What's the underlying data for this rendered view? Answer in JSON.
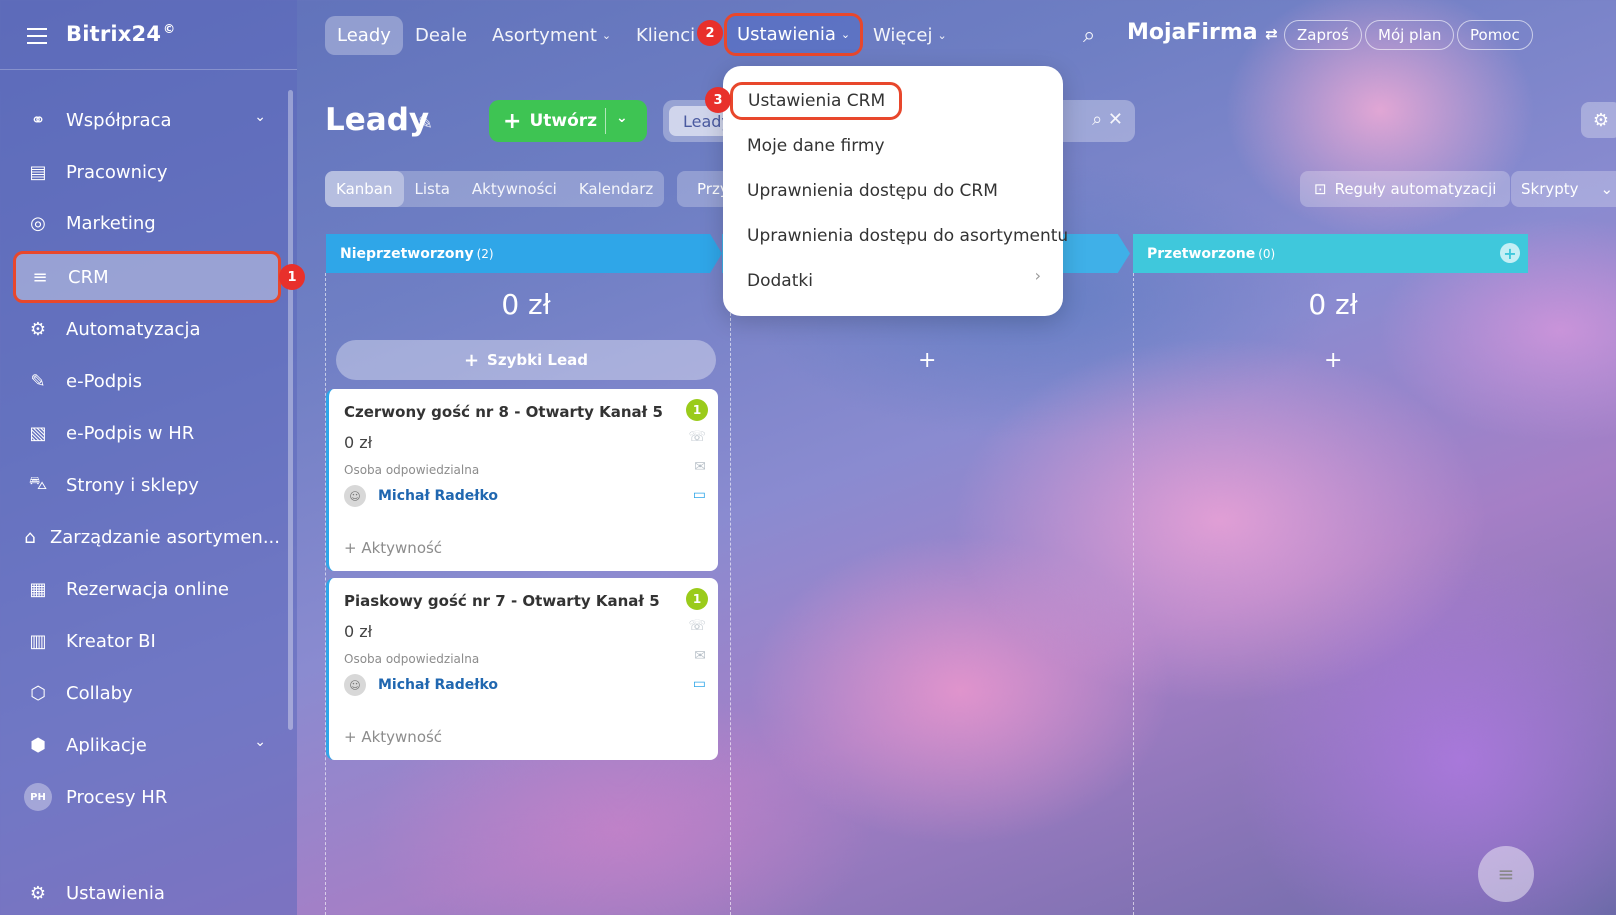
{
  "app": {
    "logo": "Bitrix24",
    "logo_mark": "©"
  },
  "sidebar": {
    "items": [
      {
        "label": "Współpraca",
        "icon": "collab-icon"
      },
      {
        "label": "Pracownicy",
        "icon": "employees-icon"
      },
      {
        "label": "Marketing",
        "icon": "marketing-icon"
      },
      {
        "label": "CRM",
        "icon": "crm-icon"
      },
      {
        "label": "Automatyzacja",
        "icon": "automation-icon"
      },
      {
        "label": "e-Podpis",
        "icon": "sign-icon"
      },
      {
        "label": "e-Podpis w HR",
        "icon": "hr-sign-icon"
      },
      {
        "label": "Strony i sklepy",
        "icon": "cart-icon"
      },
      {
        "label": "Zarządzanie asortymen...",
        "icon": "inventory-icon"
      },
      {
        "label": "Rezerwacja online",
        "icon": "calendar-icon"
      },
      {
        "label": "Kreator BI",
        "icon": "bi-chart-icon"
      },
      {
        "label": "Collaby",
        "icon": "collaby-icon"
      },
      {
        "label": "Aplikacje",
        "icon": "apps-icon"
      },
      {
        "label": "Procesy HR",
        "icon": "hr-process-icon",
        "avatar_text": "PH"
      },
      {
        "label": "Ustawienia",
        "icon": "gear-icon"
      }
    ]
  },
  "topnav": {
    "items": [
      "Leady",
      "Deale",
      "Asortyment",
      "Klienci",
      "Ustawienia",
      "Więcej"
    ],
    "company": "MojaFirma",
    "invite": "Zaproś",
    "plan": "Mój plan",
    "help": "Pomoc"
  },
  "badges": {
    "one": "1",
    "two": "2",
    "three": "3"
  },
  "toolbar": {
    "title": "Leady",
    "create": "Utwórz",
    "filter_tag": "Leady"
  },
  "views": [
    "Kanban",
    "Lista",
    "Aktywności",
    "Kalendarz"
  ],
  "views_extra": "Przy",
  "automation": "Reguły automatyzacji",
  "scripts": "Skrypty",
  "columns": [
    {
      "name": "Nieprzetworzony",
      "count": "(2)",
      "sum": "0 zł",
      "color": "#2fa6e8"
    },
    {
      "name": "",
      "count": "",
      "sum": "0 zł",
      "color": "#3fb0e8"
    },
    {
      "name": "Przetworzone",
      "count": "(0)",
      "sum": "0 zł",
      "color": "#3fc8dc"
    }
  ],
  "quick_lead": "Szybki Lead",
  "cards": [
    {
      "title": "Czerwony gość nr 8 - Otwarty Kanał 5",
      "amount": "0 zł",
      "resp_label": "Osoba odpowiedzialna",
      "user": "Michał Radełko",
      "activity": "+ Aktywność",
      "badge": "1"
    },
    {
      "title": "Piaskowy gość nr 7 - Otwarty Kanał 5",
      "amount": "0 zł",
      "resp_label": "Osoba odpowiedzialna",
      "user": "Michał Radełko",
      "activity": "+ Aktywność",
      "badge": "1"
    }
  ],
  "dropdown": {
    "items": [
      "Ustawienia CRM",
      "Moje dane firmy",
      "Uprawnienia dostępu do CRM",
      "Uprawnienia dostępu do asortymentu",
      "Dodatki"
    ]
  },
  "colors": {
    "accent_green": "#3ec453",
    "highlight_red": "#e8472c",
    "badge_red": "#e8302b"
  }
}
